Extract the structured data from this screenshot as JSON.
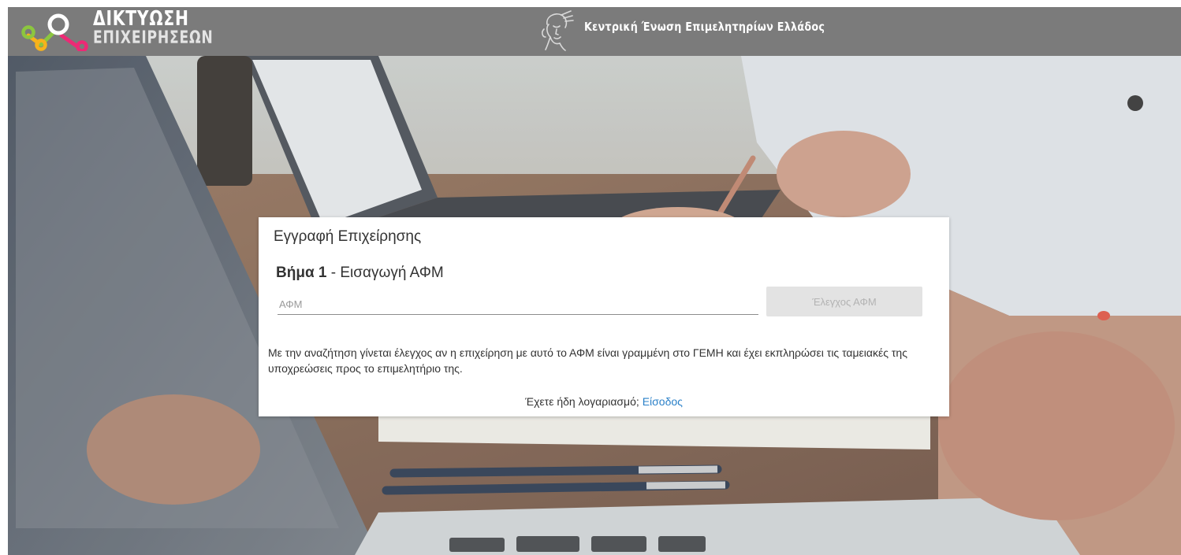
{
  "header": {
    "logo_line1": "ΔΙΚΤΥΩΣΗ",
    "logo_line2": "ΕΠΙΧΕΙΡΗΣΕΩΝ",
    "org_name": "Κεντρική Ένωση Επιμελητηρίων Ελλάδος",
    "bar_color": "#7b7b7b",
    "logo_colors": [
      "#8cc63f",
      "#f7b21b",
      "#ec2a75"
    ]
  },
  "card": {
    "title": "Εγγραφή Επιχείρησης",
    "step_label": "Βήμα 1",
    "step_separator": " - ",
    "step_text": "Εισαγωγή ΑΦΜ",
    "afm_placeholder": "ΑΦΜ",
    "afm_value": "",
    "check_button": "Έλεγχος ΑΦΜ",
    "info": "Με την αναζήτηση γίνεται έλεγχος αν η επιχείρηση με αυτό το ΑΦΜ είναι γραμμένη στο ΓΕΜΗ και έχει εκπληρώσει τις ταμειακές της υποχρεώσεις προς το επιμελητήριο της.",
    "login_prompt": "Έχετε ήδη λογαριασμό;",
    "login_link": "Είσοδος",
    "link_color": "#2a80c8"
  },
  "icons": {
    "logo": "network-nodes-icon",
    "emblem": "hermes-head-icon"
  }
}
